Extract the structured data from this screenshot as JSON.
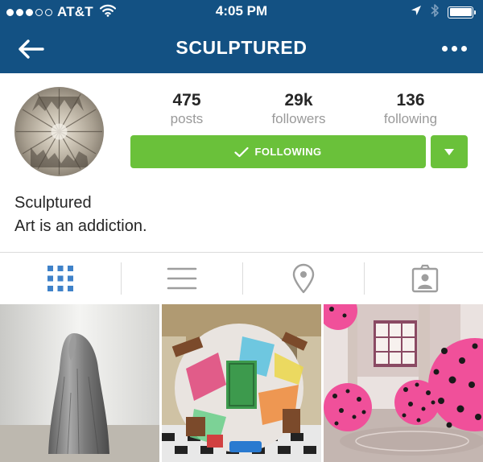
{
  "status_bar": {
    "carrier": "AT&T",
    "time": "4:05 PM",
    "signal_bars": 3,
    "signal_total": 5,
    "battery_level": 1.0
  },
  "header": {
    "title": "SCULPTURED"
  },
  "profile": {
    "stats": [
      {
        "value": "475",
        "label": "posts"
      },
      {
        "value": "29k",
        "label": "followers"
      },
      {
        "value": "136",
        "label": "following"
      }
    ],
    "follow_button_label": "FOLLOWING",
    "name": "Sculptured",
    "bio": "Art is an addiction."
  },
  "tabs": [
    {
      "icon": "grid-icon",
      "active": true
    },
    {
      "icon": "list-icon",
      "active": false
    },
    {
      "icon": "location-pin-icon",
      "active": false
    },
    {
      "icon": "tagged-photos-icon",
      "active": false
    }
  ],
  "colors": {
    "header": "#135183",
    "follow": "#6ac13a",
    "active_tab": "#3f82c9",
    "inactive_tab": "#9e9e9e"
  }
}
